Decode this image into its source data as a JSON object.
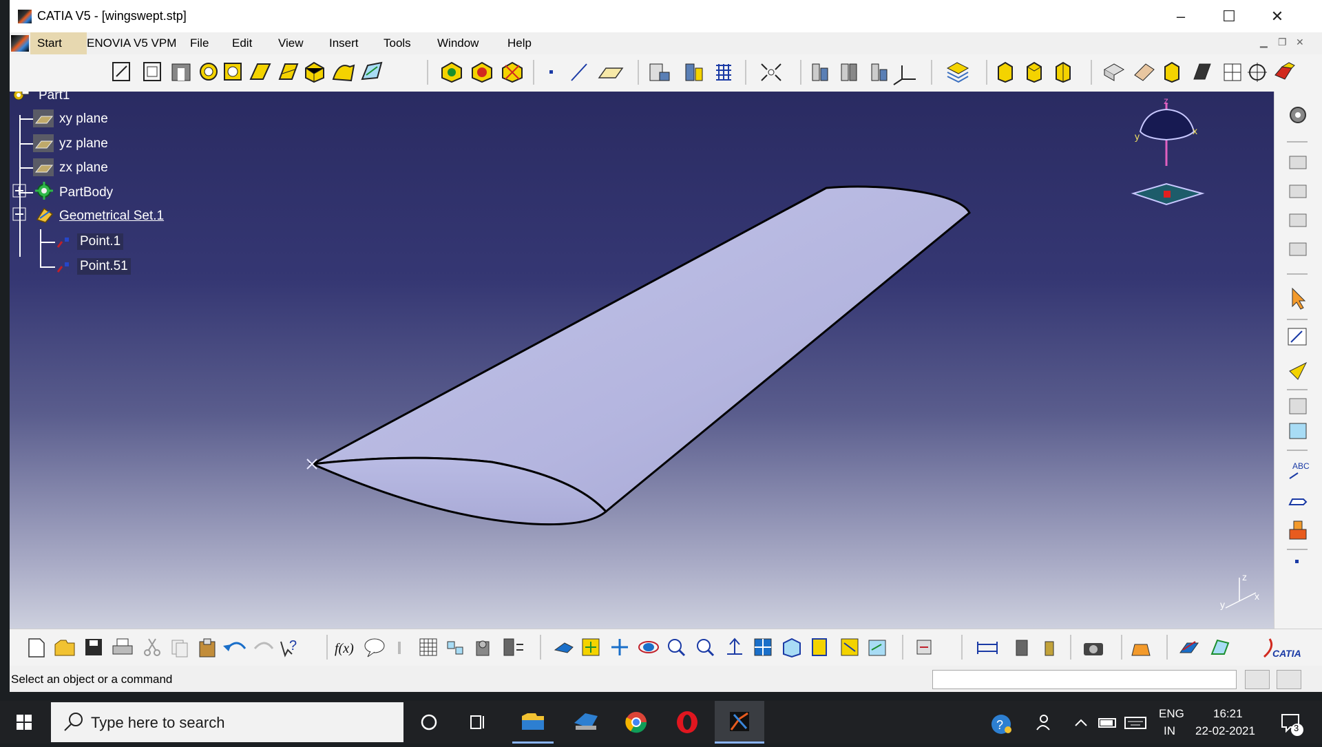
{
  "window": {
    "title": "CATIA V5 - [wingswept.stp]",
    "controls": {
      "minimize": "–",
      "maximize": "☐",
      "close": "✕"
    }
  },
  "menubar": {
    "items": [
      "Start",
      "ENOVIA V5 VPM",
      "File",
      "Edit",
      "View",
      "Insert",
      "Tools",
      "Window",
      "Help"
    ]
  },
  "toolbar_top": {
    "icons": [
      "sketch-icon",
      "pad-icon",
      "pocket-icon",
      "shaft-icon",
      "hole-icon",
      "rib-icon",
      "slot-icon",
      "multi-section-solid-icon",
      "sweep-icon",
      "rib-surface-icon",
      "extrude-surface-icon",
      "revolve-surface-icon",
      "multi-section-surface-icon",
      "point-icon",
      "line-icon",
      "plane-icon",
      "analysis-icon",
      "measure-icon",
      "grid-icon",
      "fit-all-icon",
      "multi-view-icon",
      "sketch-analysis-icon",
      "axis-icon",
      "normal-view-icon",
      "layer-icon",
      "iso-view-icon",
      "front-view-icon",
      "top-view-icon",
      "render-icon",
      "shading-icon",
      "solid-icon",
      "edges-icon",
      "hidden-icon",
      "compass-icon",
      "material-icon"
    ]
  },
  "tree": {
    "root": "Part1",
    "items": [
      {
        "label": "xy plane",
        "icon": "plane-icon"
      },
      {
        "label": "yz plane",
        "icon": "plane-icon"
      },
      {
        "label": "zx plane",
        "icon": "plane-icon"
      },
      {
        "label": "PartBody",
        "icon": "gear-icon"
      },
      {
        "label": "Geometrical Set.1",
        "icon": "geometrical-set-icon"
      },
      {
        "label": "Point.1",
        "icon": "point-icon"
      },
      {
        "label": "Point.51",
        "icon": "point-icon"
      }
    ]
  },
  "compass": {
    "axis_z": "z",
    "axis_x": "x",
    "axis_y": "y"
  },
  "axis_triad": {
    "z": "z",
    "y": "y",
    "x": "x"
  },
  "toolbar_bottom": {
    "icons": [
      "new-icon",
      "open-icon",
      "save-icon",
      "print-icon",
      "cut-icon",
      "copy-icon",
      "paste-icon",
      "undo-icon",
      "redo-icon",
      "help-icon",
      "formula-icon",
      "comment-icon",
      "link-icon",
      "table-icon",
      "design-table-icon",
      "catalog-icon",
      "knowledge-icon",
      "fly-icon",
      "fit-all-icon",
      "pan-icon",
      "rotate-icon",
      "zoom-in-icon",
      "zoom-out-icon",
      "normal-view-icon",
      "multi-view-icon",
      "iso-icon",
      "shading-icon",
      "hide-show-icon",
      "swap-icon",
      "measure-between-icon",
      "measure-item-icon",
      "mass-icon",
      "capture-icon",
      "apply-material-icon",
      "sketch-analysis-icon",
      "catia-logo-icon"
    ]
  },
  "status": {
    "message": "Select an object or a command"
  },
  "taskbar": {
    "search_placeholder": "Type here to search",
    "apps": [
      "cortana-icon",
      "task-view-icon",
      "file-explorer-icon",
      "catia-launcher-icon",
      "chrome-icon",
      "opera-icon",
      "catia-active-icon"
    ],
    "lang_top": "ENG",
    "lang_bottom": "IN",
    "time": "16:21",
    "date": "22-02-2021",
    "notifications": "3"
  }
}
